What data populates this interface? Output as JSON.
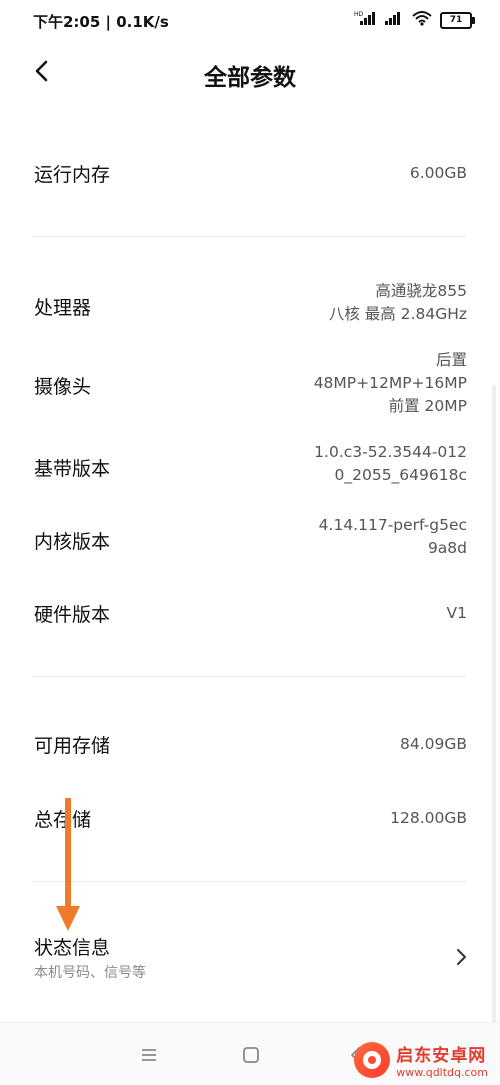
{
  "status_bar": {
    "time_speed": "下午2:05 | 0.1K/s",
    "battery": "71"
  },
  "header": {
    "title": "全部参数"
  },
  "specs": {
    "ram": {
      "label": "运行内存",
      "value": "6.00GB"
    },
    "cpu": {
      "label": "处理器",
      "value_lines": [
        "高通骁龙855",
        "八核 最高 2.84GHz"
      ]
    },
    "camera": {
      "label": "摄像头",
      "value_lines": [
        "后置",
        "48MP+12MP+16MP",
        "前置 20MP"
      ]
    },
    "baseband": {
      "label": "基带版本",
      "value_lines": [
        "1.0.c3-52.3544-012",
        "0_2055_649618c"
      ]
    },
    "kernel": {
      "label": "内核版本",
      "value_lines": [
        "4.14.117-perf-g5ec",
        "9a8d"
      ]
    },
    "hardware": {
      "label": "硬件版本",
      "value": "V1"
    },
    "available_storage": {
      "label": "可用存储",
      "value": "84.09GB"
    },
    "total_storage": {
      "label": "总存储",
      "value": "128.00GB"
    }
  },
  "status_info": {
    "title": "状态信息",
    "subtitle": "本机号码、信号等"
  },
  "watermark": {
    "title": "启东安卓网",
    "url": "www.qdltdq.com"
  },
  "colors": {
    "arrow": "#f07a2a",
    "watermark": "#e23b2f"
  }
}
